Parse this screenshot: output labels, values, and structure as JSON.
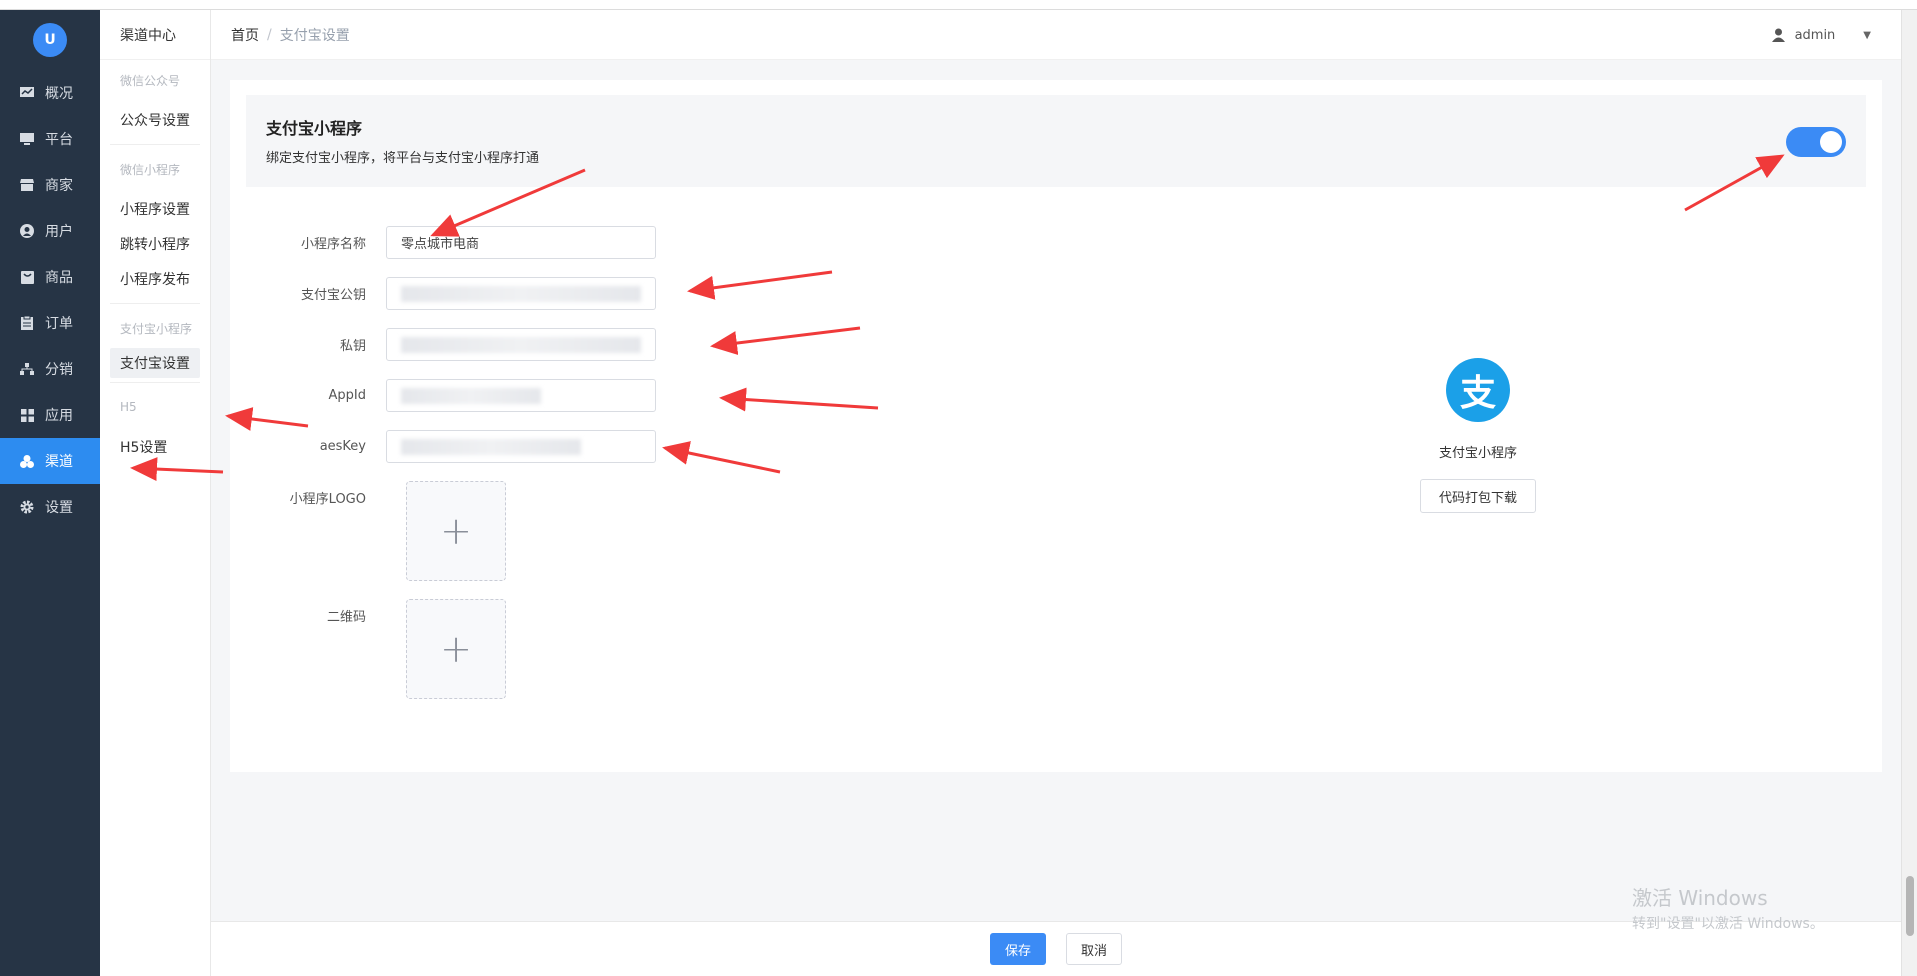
{
  "sidebar": {
    "logo_text": "U",
    "items": [
      {
        "label": "概况",
        "icon": "chart-icon"
      },
      {
        "label": "平台",
        "icon": "monitor-icon"
      },
      {
        "label": "商家",
        "icon": "store-icon"
      },
      {
        "label": "用户",
        "icon": "user-icon"
      },
      {
        "label": "商品",
        "icon": "goods-icon"
      },
      {
        "label": "订单",
        "icon": "order-icon"
      },
      {
        "label": "分销",
        "icon": "network-icon"
      },
      {
        "label": "应用",
        "icon": "apps-icon"
      },
      {
        "label": "渠道",
        "icon": "channel-icon",
        "active": true
      },
      {
        "label": "设置",
        "icon": "gear-icon"
      }
    ]
  },
  "subnav": {
    "title": "渠道中心",
    "groups": [
      {
        "title": "微信公众号",
        "items": [
          "公众号设置"
        ]
      },
      {
        "title": "微信小程序",
        "items": [
          "小程序设置",
          "跳转小程序",
          "小程序发布"
        ]
      },
      {
        "title": "支付宝小程序",
        "items": [
          "支付宝设置"
        ]
      },
      {
        "title": "H5",
        "items": [
          "H5设置"
        ]
      }
    ]
  },
  "header": {
    "breadcrumb_home": "首页",
    "breadcrumb_sep": "/",
    "breadcrumb_current": "支付宝设置",
    "user_name": "admin"
  },
  "banner": {
    "title": "支付宝小程序",
    "desc": "绑定支付宝小程序，将平台与支付宝小程序打通",
    "enabled": true
  },
  "form": {
    "name_label": "小程序名称",
    "name_value": "零点城市电商",
    "pubkey_label": "支付宝公钥",
    "privkey_label": "私钥",
    "appid_label": "AppId",
    "aeskey_label": "aesKey",
    "logo_label": "小程序LOGO",
    "qrcode_label": "二维码",
    "plus": "+"
  },
  "ali": {
    "logo_glyph": "支",
    "name": "支付宝小程序",
    "download_label": "代码打包下载"
  },
  "footer": {
    "save": "保存",
    "cancel": "取消"
  },
  "watermark": {
    "line1": "激活 Windows",
    "line2": "转到\"设置\"以激活 Windows。"
  },
  "colors": {
    "sidebar_bg": "#263445",
    "primary": "#3b8bf5",
    "alipay": "#1ba0e8",
    "annotation": "#f03a3a"
  }
}
